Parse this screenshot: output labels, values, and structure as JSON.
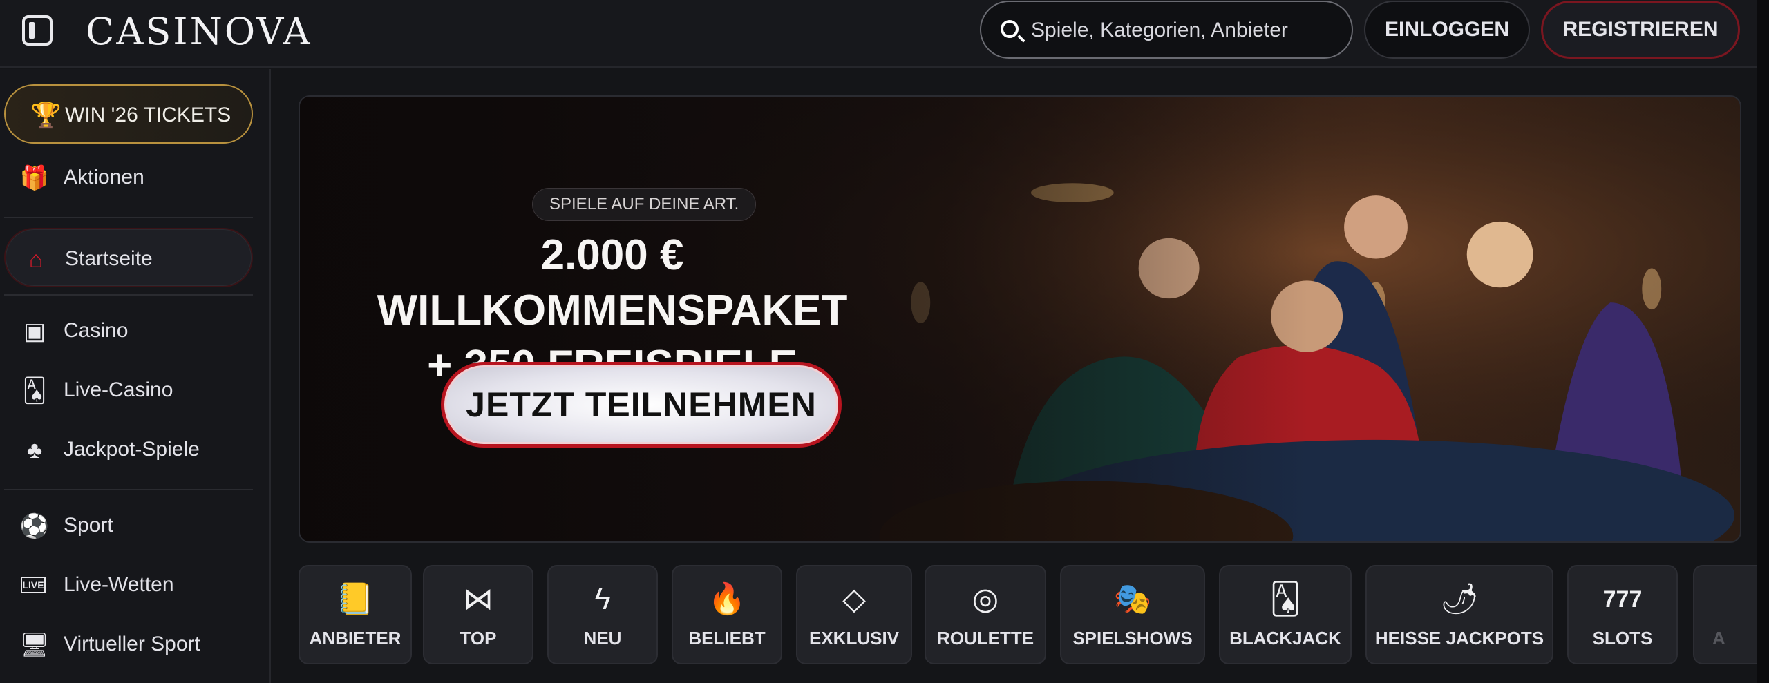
{
  "header": {
    "logo": "CASINOVA",
    "search_placeholder": "Spiele, Kategorien, Anbieter",
    "login_label": "EINLOGGEN",
    "register_label": "REGISTRIEREN"
  },
  "sidebar": {
    "promo_label": "WIN '26 TICKETS",
    "items": [
      {
        "label": "Aktionen",
        "icon": "gift-icon"
      },
      {
        "label": "Startseite",
        "icon": "home-icon",
        "active": true
      },
      {
        "label": "Casino",
        "icon": "slot-machine-icon"
      },
      {
        "label": "Live-Casino",
        "icon": "live-cards-icon"
      },
      {
        "label": "Jackpot-Spiele",
        "icon": "clover-icon"
      },
      {
        "label": "Sport",
        "icon": "soccer-ball-icon"
      },
      {
        "label": "Live-Wetten",
        "icon": "live-badge-icon"
      },
      {
        "label": "Virtueller Sport",
        "icon": "virtual-sport-icon"
      }
    ]
  },
  "banner": {
    "tag": "SPIELE AUF DEINE ART.",
    "title_line1": "2.000 € WILLKOMMENSPAKET",
    "title_line2": "+ 350 FREISPIELE",
    "cta_label": "JETZT TEILNEHMEN"
  },
  "categories": [
    {
      "label": "ANBIETER",
      "icon": "provider-book-icon"
    },
    {
      "label": "TOP",
      "icon": "bowtie-icon"
    },
    {
      "label": "NEU",
      "icon": "lightning-icon"
    },
    {
      "label": "BELIEBT",
      "icon": "flame-icon"
    },
    {
      "label": "EXKLUSIV",
      "icon": "diamond-icon"
    },
    {
      "label": "ROULETTE",
      "icon": "roulette-icon"
    },
    {
      "label": "SPIELSHOWS",
      "icon": "mask-icon"
    },
    {
      "label": "BLACKJACK",
      "icon": "playing-cards-icon"
    },
    {
      "label": "HEISSE JACKPOTS",
      "icon": "hot-pepper-icon"
    },
    {
      "label": "SLOTS",
      "icon": "sevens-icon"
    },
    {
      "label": "A",
      "icon": "partial-icon"
    }
  ],
  "colors": {
    "accent_red": "#b8141f",
    "gold": "#b8913e",
    "background": "#141518"
  }
}
